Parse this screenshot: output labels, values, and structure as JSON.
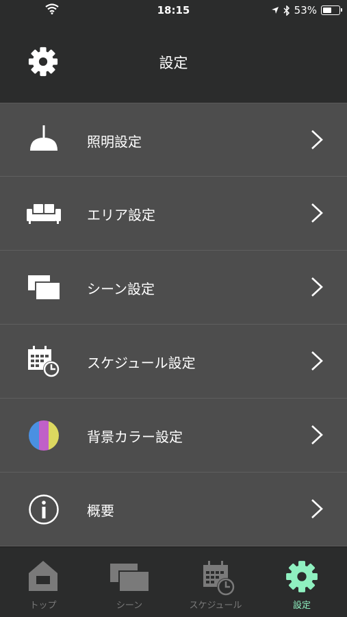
{
  "status": {
    "time": "18:15",
    "battery": "53%",
    "battery_level": 0.53
  },
  "header": {
    "title": "設定"
  },
  "menu": {
    "items": [
      {
        "label": "照明設定",
        "icon": "lamp-icon"
      },
      {
        "label": "エリア設定",
        "icon": "sofa-icon"
      },
      {
        "label": "シーン設定",
        "icon": "scenes-icon"
      },
      {
        "label": "スケジュール設定",
        "icon": "calendar-clock-icon"
      },
      {
        "label": "背景カラー設定",
        "icon": "color-circle-icon"
      },
      {
        "label": "概要",
        "icon": "info-icon"
      }
    ]
  },
  "tabs": [
    {
      "label": "トップ",
      "icon": "home-icon"
    },
    {
      "label": "シーン",
      "icon": "scenes-icon"
    },
    {
      "label": "スケジュール",
      "icon": "calendar-clock-icon"
    },
    {
      "label": "設定",
      "icon": "gear-icon",
      "active": true
    }
  ],
  "colors": {
    "background": "#4a4a4a",
    "header": "#2b2c2c",
    "accent": "#8ff0c0",
    "inactive": "#7a7a7a",
    "palette": [
      "#4a90e2",
      "#c060c8",
      "#dcd860"
    ]
  }
}
